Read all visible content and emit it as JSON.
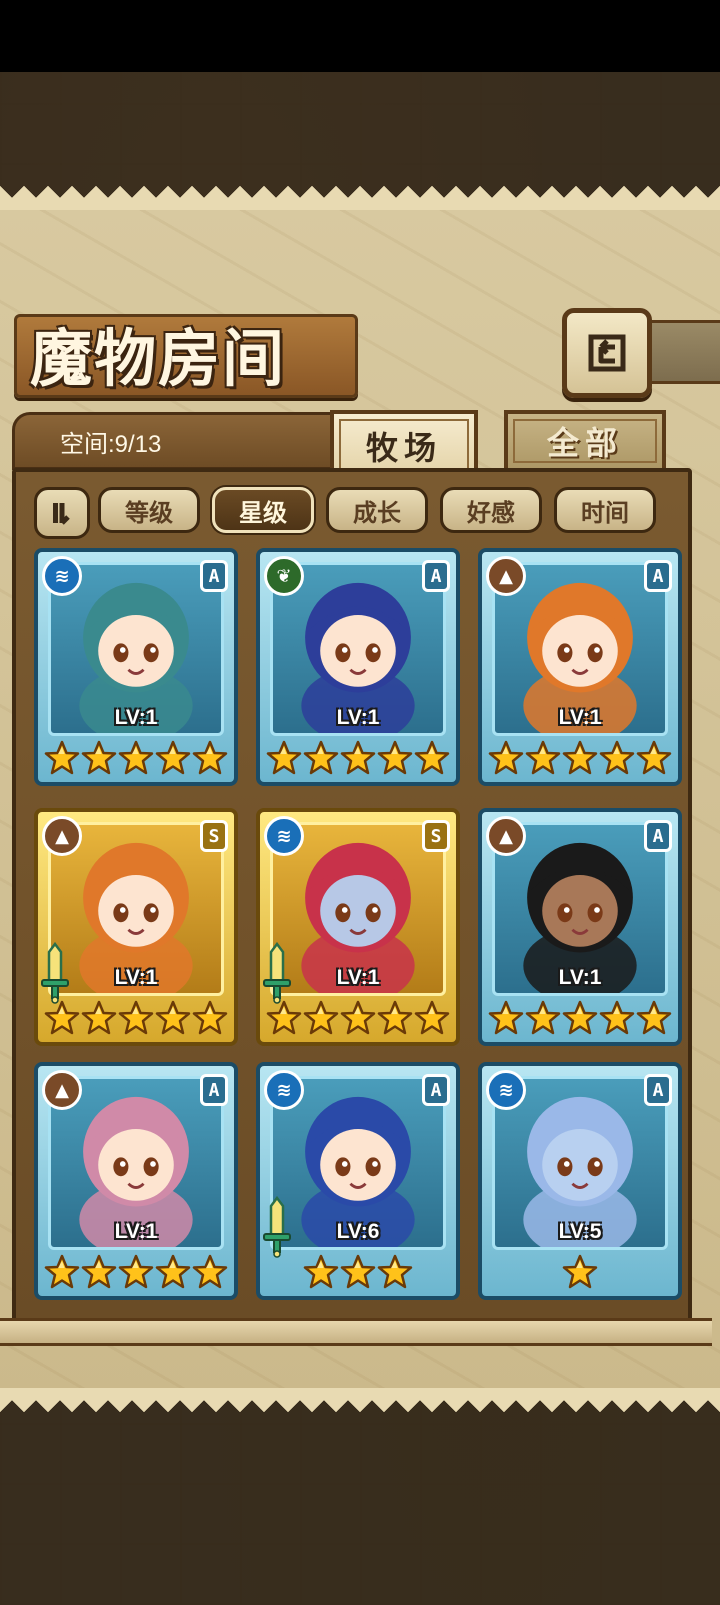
{
  "title": "魔物房间",
  "space": {
    "label": "空间:9/13"
  },
  "tabs": [
    {
      "label": "牧场",
      "active": true
    },
    {
      "label": "全部",
      "active": false
    }
  ],
  "sort_buttons": [
    {
      "label": "等级",
      "active": false
    },
    {
      "label": "星级",
      "active": true
    },
    {
      "label": "成长",
      "active": false
    },
    {
      "label": "好感",
      "active": false
    },
    {
      "label": "时间",
      "active": false
    }
  ],
  "monsters": [
    {
      "level": "LV:1",
      "stars": 5,
      "rank": "A",
      "element": "water-icon",
      "equipped": false,
      "hair": "#3a8a8e",
      "skin": "#fde4d0"
    },
    {
      "level": "LV:1",
      "stars": 5,
      "rank": "A",
      "element": "leaf-icon",
      "equipped": false,
      "hair": "#2d3e9a",
      "skin": "#fde4d0"
    },
    {
      "level": "LV:1",
      "stars": 5,
      "rank": "A",
      "element": "mountain-icon",
      "equipped": false,
      "hair": "#e0782a",
      "skin": "#fde4d0"
    },
    {
      "level": "LV:1",
      "stars": 5,
      "rank": "S",
      "element": "mountain-icon",
      "equipped": true,
      "hair": "#e0782a",
      "skin": "#fde4d0"
    },
    {
      "level": "LV:1",
      "stars": 5,
      "rank": "S",
      "element": "water-icon",
      "equipped": true,
      "hair": "#c8324a",
      "skin": "#b7c8e6"
    },
    {
      "level": "LV:1",
      "stars": 5,
      "rank": "A",
      "element": "mountain-icon",
      "equipped": false,
      "hair": "#1a1a1a",
      "skin": "#a87858"
    },
    {
      "level": "LV:1",
      "stars": 5,
      "rank": "A",
      "element": "mountain-icon",
      "equipped": false,
      "hair": "#d08aa8",
      "skin": "#fde4d0"
    },
    {
      "level": "LV:6",
      "stars": 3,
      "rank": "A",
      "element": "water-icon",
      "equipped": true,
      "hair": "#2a4aa8",
      "skin": "#fde4d0"
    },
    {
      "level": "LV:5",
      "stars": 1,
      "rank": "A",
      "element": "water-icon",
      "equipped": false,
      "hair": "#9ab8e8",
      "skin": "#b8d0f0"
    }
  ]
}
